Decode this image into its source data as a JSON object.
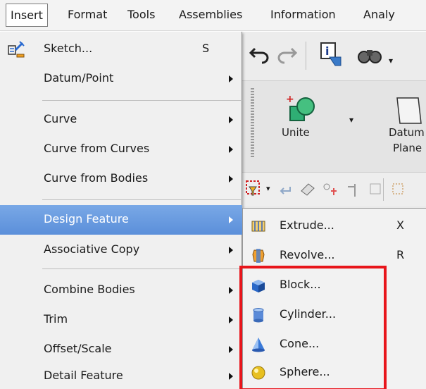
{
  "menubar": {
    "items": [
      {
        "label": "Insert",
        "active": true
      },
      {
        "label": "Format"
      },
      {
        "label": "Tools"
      },
      {
        "label": "Assemblies"
      },
      {
        "label": "Information"
      },
      {
        "label": "Analy"
      }
    ]
  },
  "toolbar": {
    "unite_label": "Unite",
    "datum_plane_label_line1": "Datum",
    "datum_plane_label_line2": "Plane"
  },
  "insert_menu": {
    "items": [
      {
        "label": "Sketch...",
        "shortcut": "S",
        "icon": "sketch-icon"
      },
      {
        "label": "Datum/Point",
        "submenu": true
      },
      {
        "label": "Curve",
        "submenu": true
      },
      {
        "label": "Curve from Curves",
        "submenu": true
      },
      {
        "label": "Curve from Bodies",
        "submenu": true
      },
      {
        "label": "Design Feature",
        "submenu": true,
        "highlighted": true
      },
      {
        "label": "Associative Copy",
        "submenu": true
      },
      {
        "label": "Combine Bodies",
        "submenu": true
      },
      {
        "label": "Trim",
        "submenu": true
      },
      {
        "label": "Offset/Scale",
        "submenu": true
      },
      {
        "label": "Detail Feature",
        "submenu": true
      }
    ]
  },
  "design_feature_submenu": {
    "items": [
      {
        "label": "Extrude...",
        "shortcut": "X",
        "icon": "extrude-icon"
      },
      {
        "label": "Revolve...",
        "shortcut": "R",
        "icon": "revolve-icon"
      },
      {
        "label": "Block...",
        "icon": "block-icon"
      },
      {
        "label": "Cylinder...",
        "icon": "cylinder-icon"
      },
      {
        "label": "Cone...",
        "icon": "cone-icon"
      },
      {
        "label": "Sphere...",
        "icon": "sphere-icon"
      }
    ]
  },
  "colors": {
    "highlight": "#5b8fda",
    "annotation_box": "#e8151b"
  }
}
